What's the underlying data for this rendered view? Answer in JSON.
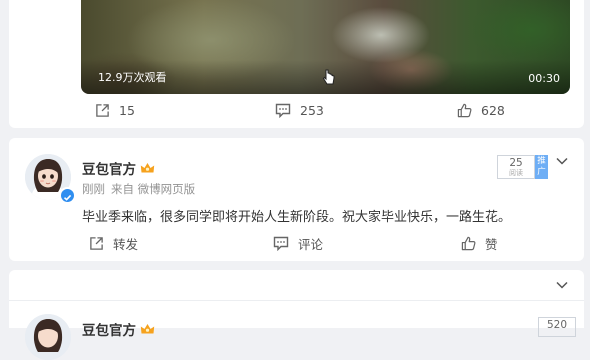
{
  "video_post": {
    "views": "12.9万次观看",
    "duration": "00:30",
    "actions": {
      "repost_count": "15",
      "comment_count": "253",
      "like_count": "628"
    }
  },
  "post": {
    "author": "豆包官方",
    "time": "刚刚",
    "source": "来自 微博网页版",
    "reads": {
      "count": "25",
      "label": "阅读"
    },
    "promote_label": "推广",
    "text": "毕业季来临，很多同学即将开始人生新阶段。祝大家毕业快乐，一路生花。",
    "actions": {
      "repost": "转发",
      "comment": "评论",
      "like": "赞"
    }
  },
  "next_post": {
    "author": "豆包官方",
    "reads": {
      "count": "520"
    }
  },
  "icons": {
    "repost": "share-icon",
    "comment": "comment-icon",
    "like": "thumbs-up-icon",
    "more": "chevron-down-icon",
    "vip": "crown-icon",
    "verified": "verified-badge-icon"
  },
  "colors": {
    "accent": "#2f8ef0",
    "promote": "#6eaef5",
    "crown": "#f6a21e"
  }
}
